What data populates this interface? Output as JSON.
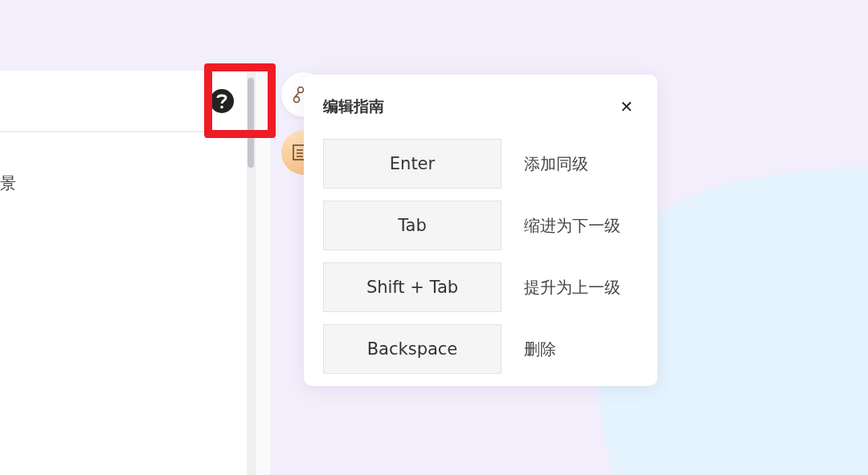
{
  "panel": {
    "item_text": "景"
  },
  "guide": {
    "title": "编辑指南",
    "close": "✕",
    "shortcuts": [
      {
        "key": "Enter",
        "action": "添加同级"
      },
      {
        "key": "Tab",
        "action": "缩进为下一级"
      },
      {
        "key": "Shift + Tab",
        "action": "提升为上一级"
      },
      {
        "key": "Backspace",
        "action": "删除"
      }
    ]
  }
}
